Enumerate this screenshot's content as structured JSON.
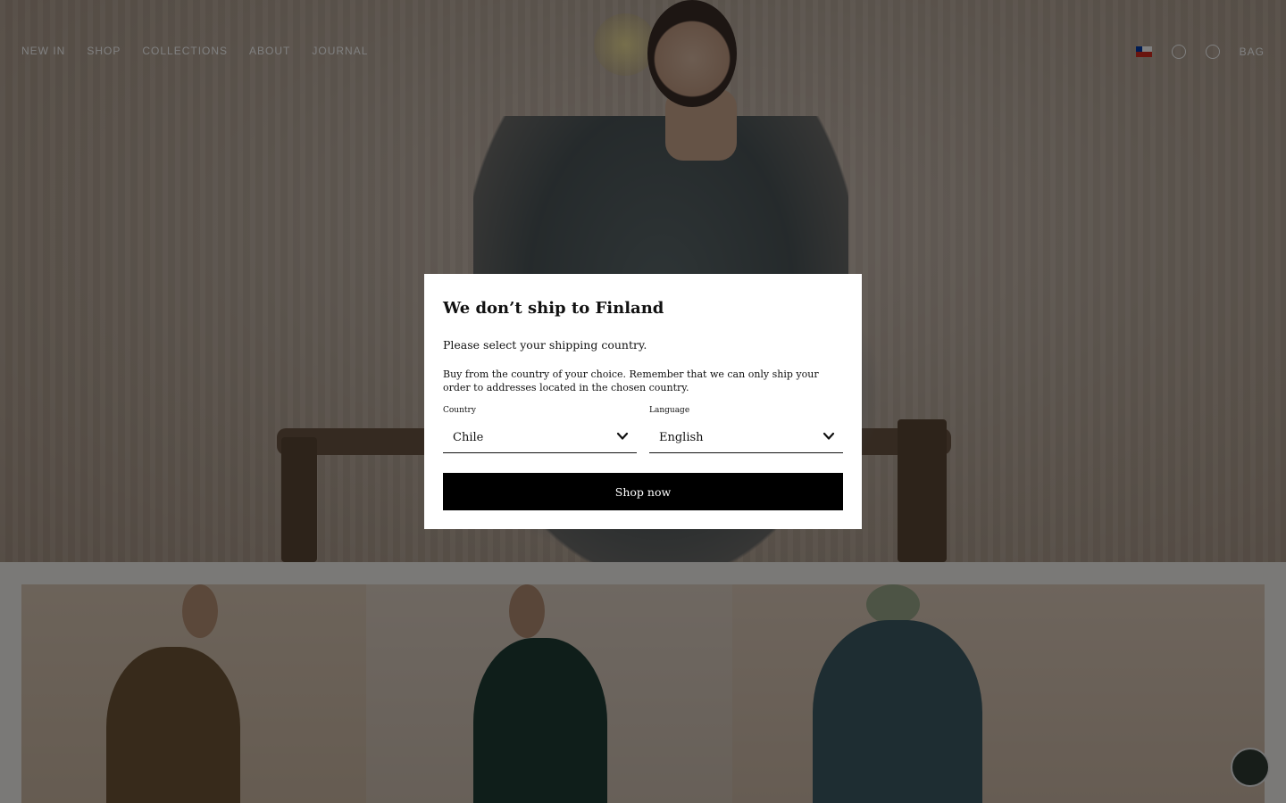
{
  "nav": {
    "left_links": [
      {
        "label": "New In"
      },
      {
        "label": "Shop"
      },
      {
        "label": "Collections"
      },
      {
        "label": "About"
      },
      {
        "label": "Journal"
      }
    ],
    "right_links": [
      {
        "label": "Bag"
      }
    ]
  },
  "modal": {
    "title": "We don’t ship to Finland",
    "subtitle": "Please select your shipping country.",
    "note": "Buy from the country of your choice. Remember that we can only ship your order to addresses located in the chosen country.",
    "country": {
      "label": "Country",
      "value": "Chile"
    },
    "language": {
      "label": "Language",
      "value": "English"
    },
    "button_label": "Shop now"
  },
  "colors": {
    "overlay": "#000000",
    "button_bg": "#000000",
    "button_text": "#ffffff",
    "flag": [
      "#ffffff",
      "#d52b1e",
      "#0039a6"
    ]
  },
  "icons": [
    "chile-flag-icon",
    "search-icon",
    "account-icon",
    "chevron-down-icon",
    "chat-icon"
  ]
}
